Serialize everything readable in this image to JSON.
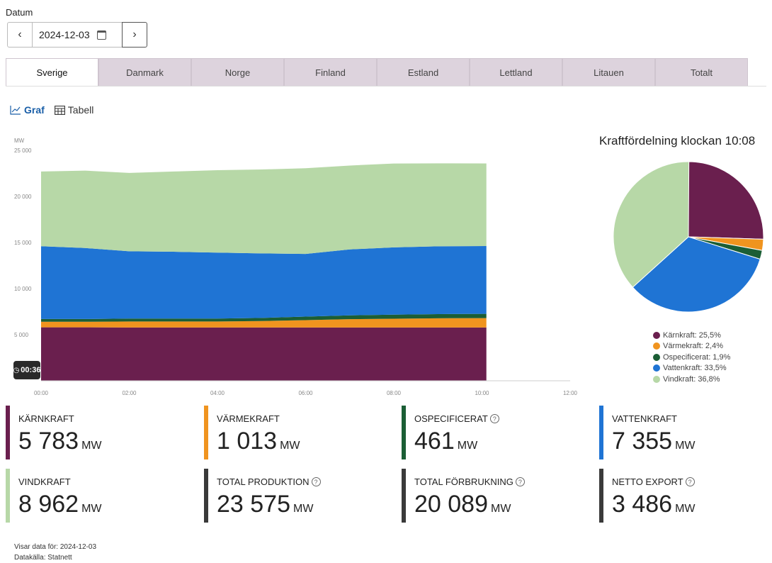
{
  "date_section": {
    "label": "Datum",
    "value": "2024-12-03",
    "prev_icon": "chevron-left-icon",
    "next_icon": "chevron-right-icon"
  },
  "tabs": [
    {
      "label": "Sverige",
      "active": true
    },
    {
      "label": "Danmark",
      "active": false
    },
    {
      "label": "Norge",
      "active": false
    },
    {
      "label": "Finland",
      "active": false
    },
    {
      "label": "Estland",
      "active": false
    },
    {
      "label": "Lettland",
      "active": false
    },
    {
      "label": "Litauen",
      "active": false
    },
    {
      "label": "Totalt",
      "active": false
    }
  ],
  "view_toggle": {
    "graph_label": "Graf",
    "table_label": "Tabell"
  },
  "colors": {
    "karnkraft": "#6a1f4e",
    "varmekraft": "#f0941f",
    "ospecificerat": "#1b5e35",
    "vattenkraft": "#1f74d4",
    "vindkraft": "#b7d8a7"
  },
  "chart_data": [
    {
      "type": "area",
      "stacked": true,
      "ylabel": "MW",
      "ylim": [
        0,
        25000
      ],
      "yticks": [
        "25 000",
        "20 000",
        "15 000",
        "10 000",
        "5 000"
      ],
      "yticks_values": [
        25000,
        20000,
        15000,
        10000,
        5000
      ],
      "xticks": [
        "00:00",
        "02:00",
        "04:00",
        "06:00",
        "08:00",
        "10:00",
        "12:00"
      ],
      "xlim": [
        0,
        12
      ],
      "x": [
        0,
        1,
        2,
        3,
        4,
        5,
        6,
        7,
        8,
        9,
        10.1
      ],
      "series": [
        {
          "name": "Kärnkraft",
          "color": "#6a1f4e",
          "values": [
            5800,
            5800,
            5780,
            5780,
            5780,
            5780,
            5780,
            5780,
            5780,
            5780,
            5783
          ]
        },
        {
          "name": "Värmekraft",
          "color": "#f0941f",
          "values": [
            600,
            600,
            650,
            650,
            650,
            700,
            800,
            900,
            950,
            1000,
            1013
          ]
        },
        {
          "name": "Ospecificerat",
          "color": "#1b5e35",
          "values": [
            300,
            300,
            320,
            320,
            320,
            340,
            380,
            420,
            440,
            455,
            461
          ]
        },
        {
          "name": "Vattenkraft",
          "color": "#1f74d4",
          "values": [
            7900,
            7700,
            7300,
            7250,
            7150,
            7000,
            6800,
            7150,
            7300,
            7350,
            7355
          ]
        },
        {
          "name": "Vindkraft",
          "color": "#b7d8a7",
          "values": [
            8100,
            8400,
            8500,
            8700,
            8950,
            9100,
            9300,
            9100,
            9100,
            9000,
            8962
          ]
        }
      ],
      "time_badge": "00:36"
    },
    {
      "type": "pie",
      "title": "Kraftfördelning klockan 10:08",
      "slices": [
        {
          "name": "Kärnkraft",
          "percent": 25.5,
          "label": "Kärnkraft: 25,5%",
          "color": "#6a1f4e"
        },
        {
          "name": "Värmekraft",
          "percent": 2.4,
          "label": "Värmekraft: 2,4%",
          "color": "#f0941f"
        },
        {
          "name": "Ospecificerat",
          "percent": 1.9,
          "label": "Ospecificerat: 1,9%",
          "color": "#1b5e35"
        },
        {
          "name": "Vattenkraft",
          "percent": 33.5,
          "label": "Vattenkraft: 33,5%",
          "color": "#1f74d4"
        },
        {
          "name": "Vindkraft",
          "percent": 36.8,
          "label": "Vindkraft: 36,8%",
          "color": "#b7d8a7"
        }
      ]
    }
  ],
  "cards": [
    {
      "title": "KÄRNKRAFT",
      "value": "5 783",
      "unit": "MW",
      "color": "#6a1f4e",
      "help": false
    },
    {
      "title": "VÄRMEKRAFT",
      "value": "1 013",
      "unit": "MW",
      "color": "#f0941f",
      "help": false
    },
    {
      "title": "OSPECIFICERAT",
      "value": "461",
      "unit": "MW",
      "color": "#1b5e35",
      "help": true
    },
    {
      "title": "VATTENKRAFT",
      "value": "7 355",
      "unit": "MW",
      "color": "#1f74d4",
      "help": false
    },
    {
      "title": "VINDKRAFT",
      "value": "8 962",
      "unit": "MW",
      "color": "#b7d8a7",
      "help": false
    },
    {
      "title": "TOTAL PRODUKTION",
      "value": "23 575",
      "unit": "MW",
      "color": "#3a3a3a",
      "help": true
    },
    {
      "title": "TOTAL FÖRBRUKNING",
      "value": "20 089",
      "unit": "MW",
      "color": "#3a3a3a",
      "help": true
    },
    {
      "title": "NETTO EXPORT",
      "value": "3 486",
      "unit": "MW",
      "color": "#3a3a3a",
      "help": true
    }
  ],
  "footer": {
    "line1": "Visar data för: 2024-12-03",
    "line2": "Datakälla: Statnett"
  }
}
